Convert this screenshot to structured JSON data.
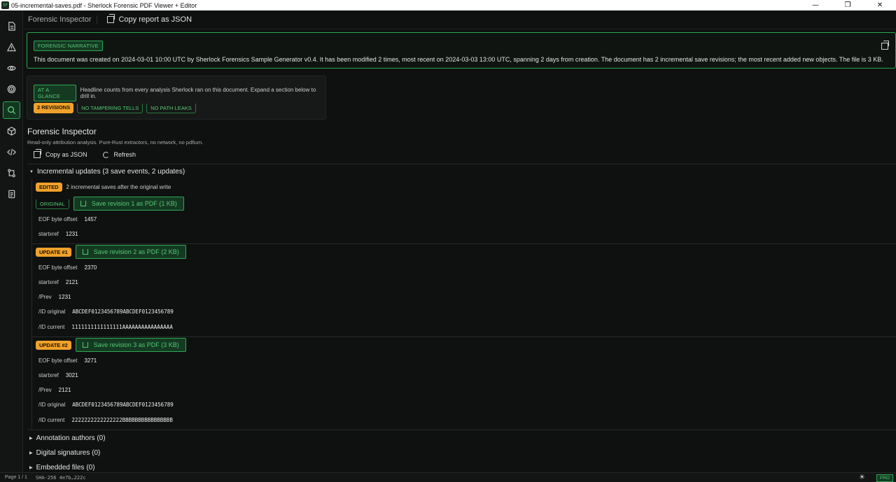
{
  "window": {
    "app_icon": "SF",
    "title": "05-incremental-saves.pdf - Sherlock Forensic PDF Viewer + Editor",
    "controls": [
      "—",
      "❐",
      "✕"
    ]
  },
  "sidebar": {
    "items": [
      {
        "icon": "document-icon"
      },
      {
        "icon": "warning-icon"
      },
      {
        "icon": "eye-icon"
      },
      {
        "icon": "fingerprint-icon"
      },
      {
        "icon": "search-icon",
        "active": true
      },
      {
        "icon": "cube-icon"
      },
      {
        "icon": "code-icon"
      },
      {
        "icon": "compare-icon"
      },
      {
        "icon": "pages-icon"
      }
    ]
  },
  "topbar": {
    "tab_label": "Forensic Inspector",
    "copy_report_label": "Copy report as JSON"
  },
  "narrative": {
    "badge": "FORENSIC NARRATIVE",
    "text": "This document was created on 2024-03-01 10:00 UTC by Sherlock Forensics Sample Generator v0.4. It has been modified 2 times, most recent on 2024-03-03 13:00 UTC, spanning 2 days from creation. The document has 2 incremental save revisions; the most recent added new objects. The file is 3 KB."
  },
  "glance": {
    "badge": "AT A GLANCE",
    "description": "Headline counts from every analysis Sherlock ran on this document. Expand a section below to drill in.",
    "chips": [
      "2 REVISIONS",
      "NO TAMPERING TELLS",
      "NO PATH LEAKS"
    ]
  },
  "inspector": {
    "title": "Forensic Inspector",
    "subtitle": "Read-only attribution analysis. Pure-Rust extractors, no network, no pdfium.",
    "copy_json_label": "Copy as JSON",
    "refresh_label": "Refresh"
  },
  "incremental": {
    "header": "Incremental updates (3 save events, 2 updates)",
    "edited_badge": "EDITED",
    "edited_text": "2 incremental saves after the original write",
    "revisions": [
      {
        "tag": "ORIGINAL",
        "save_label": "Save revision 1 as PDF (1 KB)",
        "eof_label": "EOF byte offset",
        "eof": "1457",
        "startxref_label": "startxref",
        "startxref": "1231"
      },
      {
        "tag": "UPDATE #1",
        "save_label": "Save revision 2 as PDF (2 KB)",
        "eof_label": "EOF byte offset",
        "eof": "2370",
        "startxref_label": "startxref",
        "startxref": "2121",
        "prev_label": "/Prev",
        "prev": "1231",
        "id_original_label": "/ID original",
        "id_original": "ABCDEF0123456789ABCDEF0123456789",
        "id_current_label": "/ID current",
        "id_current": "1111111111111111AAAAAAAAAAAAAAAA"
      },
      {
        "tag": "UPDATE #2",
        "save_label": "Save revision 3 as PDF (3 KB)",
        "eof_label": "EOF byte offset",
        "eof": "3271",
        "startxref_label": "startxref",
        "startxref": "3021",
        "prev_label": "/Prev",
        "prev": "2121",
        "id_original_label": "/ID original",
        "id_original": "ABCDEF0123456789ABCDEF0123456789",
        "id_current_label": "/ID current",
        "id_current": "2222222222222222BBBBBBBBBBBBBBBB"
      }
    ]
  },
  "sections": {
    "annotation_authors": "Annotation authors (0)",
    "digital_signatures": "Digital signatures (0)",
    "embedded_files": "Embedded files (0)"
  },
  "statusbar": {
    "page": "Page 1 / 1",
    "sha": "SHA-256 4e7b…222c",
    "theme_icon": "☀",
    "pro_badge": "PRO"
  },
  "colors": {
    "accent_green": "#2fa855",
    "badge_orange": "#f0a12a",
    "background": "#0f1110"
  }
}
